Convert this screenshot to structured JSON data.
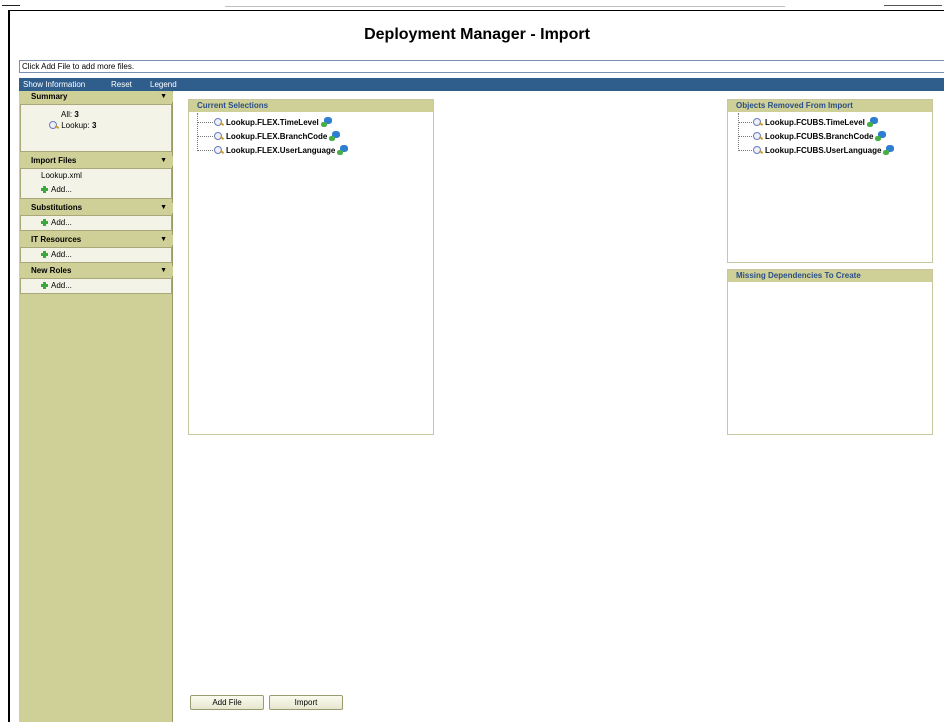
{
  "page": {
    "title": "Deployment Manager - Import",
    "hint": "Click Add File to add more files."
  },
  "menu": {
    "show_information": "Show Information",
    "reset": "Reset",
    "legend": "Legend"
  },
  "sidebar": {
    "summary": {
      "header": "Summary",
      "all_label": "All:",
      "all_count": "3",
      "lookup_label": "Lookup:",
      "lookup_count": "3"
    },
    "import_files": {
      "header": "Import Files",
      "file": "Lookup.xml",
      "add": "Add..."
    },
    "substitutions": {
      "header": "Substitutions",
      "add": "Add..."
    },
    "it_resources": {
      "header": "IT Resources",
      "add": "Add..."
    },
    "new_roles": {
      "header": "New Roles",
      "add": "Add..."
    },
    "collapse_icon": "▼"
  },
  "current_selections": {
    "header": "Current Selections",
    "items": [
      "Lookup.FLEX.TimeLevel",
      "Lookup.FLEX.BranchCode",
      "Lookup.FLEX.UserLanguage"
    ]
  },
  "removed": {
    "header": "Objects Removed From Import",
    "items": [
      "Lookup.FCUBS.TimeLevel",
      "Lookup.FCUBS.BranchCode",
      "Lookup.FCUBS.UserLanguage"
    ]
  },
  "missing": {
    "header": "Missing Dependencies To Create"
  },
  "buttons": {
    "add_file": "Add File",
    "import": "Import"
  },
  "icons": {
    "lookup": "magnifier-icon",
    "object": "object-cube-icon",
    "add": "green-plus-icon"
  },
  "colors": {
    "menubar": "#2f5d8c",
    "sidebar": "#cfcf98",
    "panel_header_text": "#2a4f86"
  }
}
